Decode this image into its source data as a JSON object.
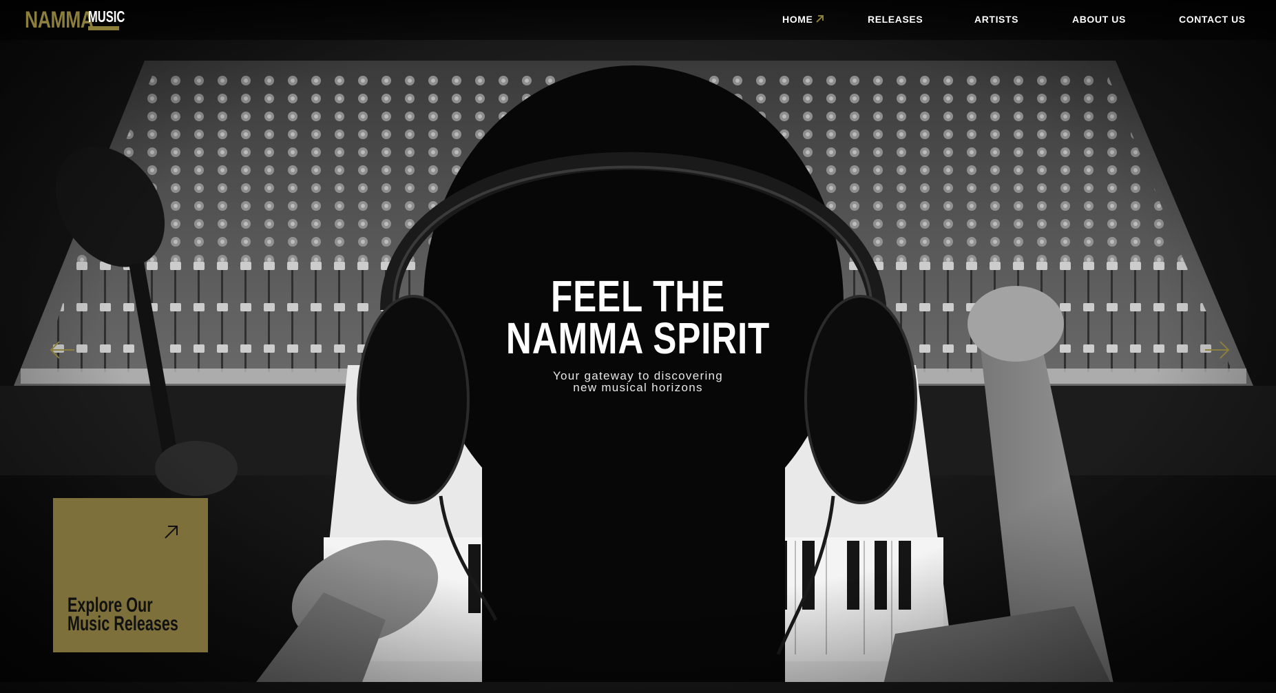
{
  "brand": {
    "logo_primary": "NAMMA",
    "logo_secondary": "MUSIC",
    "accent_color": "#8c7f3c"
  },
  "nav": {
    "items": [
      {
        "label": "HOME",
        "active": true
      },
      {
        "label": "RELEASES"
      },
      {
        "label": "ARTISTS"
      },
      {
        "label": "ABOUT US"
      },
      {
        "label": "CONTACT US"
      }
    ],
    "active_icon": "arrow-up-right-icon"
  },
  "hero": {
    "title_line1": "FEEL THE",
    "title_line2": "NAMMA SPIRIT",
    "subtitle_line1": "Your gateway to discovering",
    "subtitle_line2": "new musical horizons",
    "prev_icon": "arrow-left-icon",
    "next_icon": "arrow-right-icon"
  },
  "card": {
    "line1": "Explore Our",
    "line2": "Music Releases",
    "icon": "arrow-up-right-icon",
    "background": "#7d703a"
  }
}
